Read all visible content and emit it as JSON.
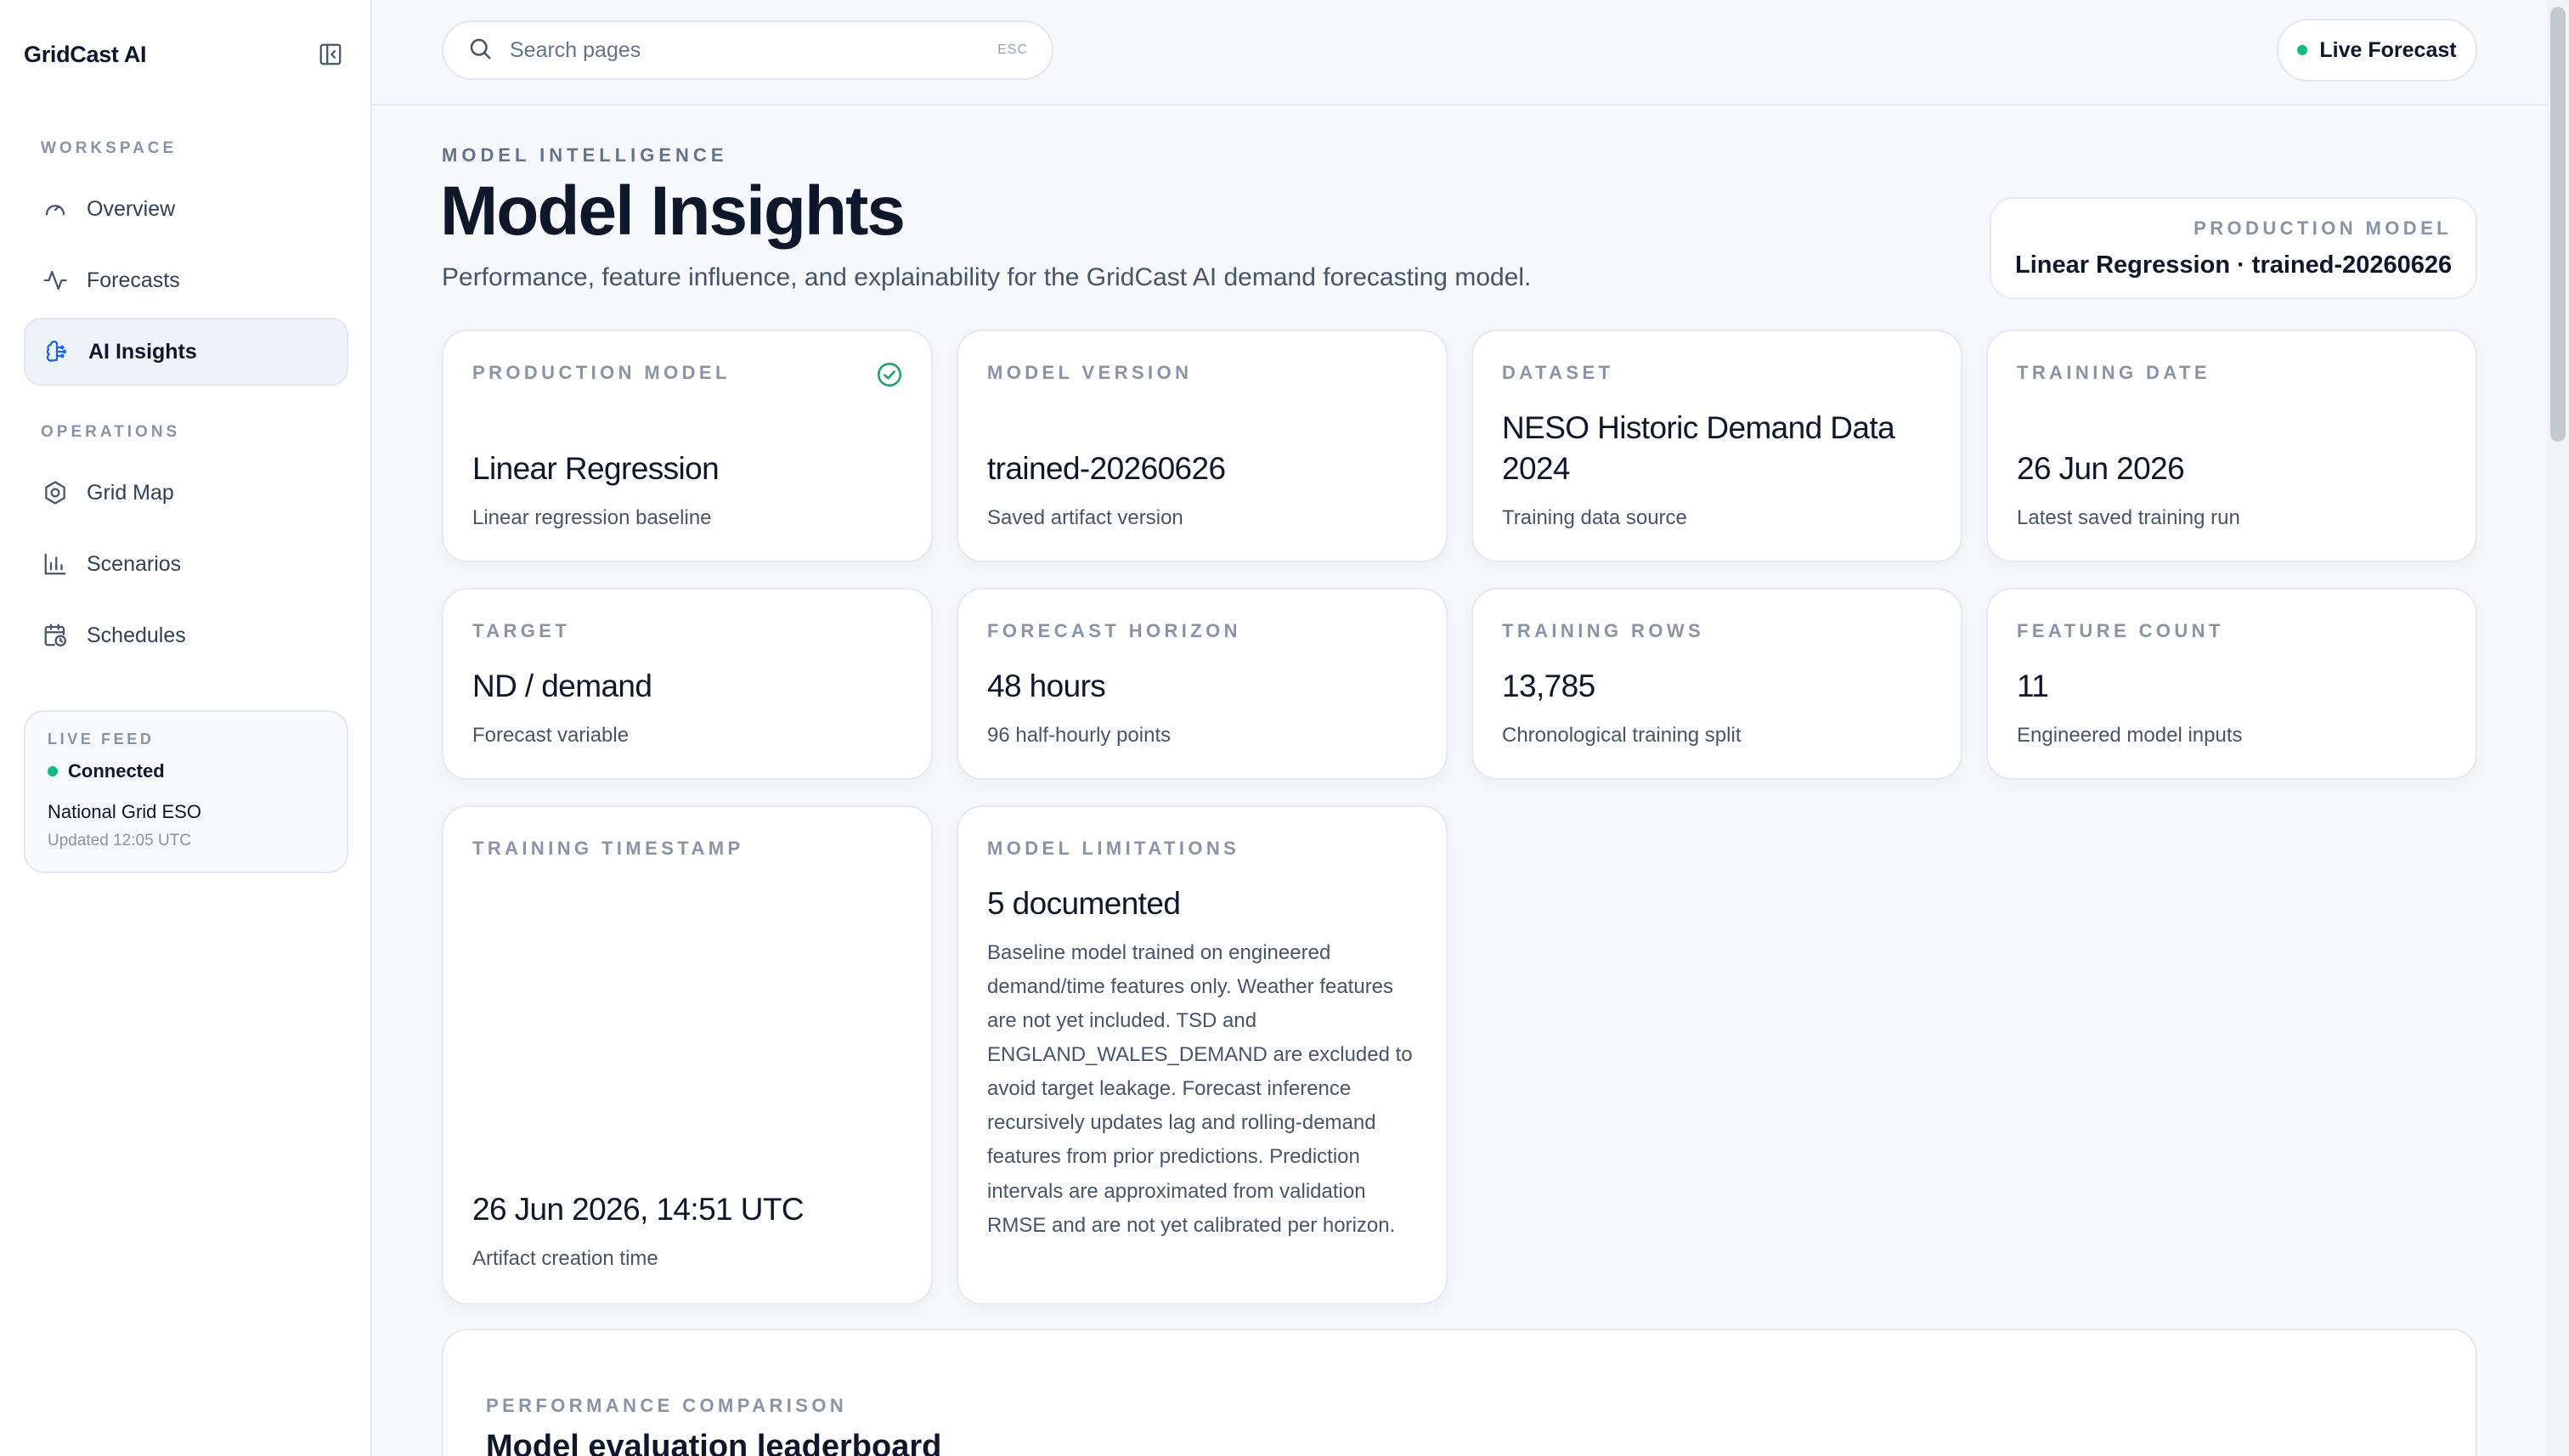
{
  "app": {
    "name": "GridCast AI"
  },
  "sidebar": {
    "workspace_label": "WORKSPACE",
    "operations_label": "OPERATIONS",
    "items": [
      {
        "label": "Overview",
        "icon": "gauge-icon"
      },
      {
        "label": "Forecasts",
        "icon": "activity-icon"
      },
      {
        "label": "AI Insights",
        "icon": "brain-icon",
        "active": true
      },
      {
        "label": "Grid Map",
        "icon": "hexagon-icon"
      },
      {
        "label": "Scenarios",
        "icon": "bar-chart-icon"
      },
      {
        "label": "Schedules",
        "icon": "calendar-clock-icon"
      }
    ],
    "live_feed": {
      "label": "LIVE FEED",
      "status": "Connected",
      "source": "National Grid ESO",
      "updated": "Updated 12:05 UTC"
    }
  },
  "topbar": {
    "search_placeholder": "Search pages",
    "search_shortcut": "ESC",
    "live_button": "Live Forecast"
  },
  "header": {
    "eyebrow": "MODEL INTELLIGENCE",
    "title": "Model Insights",
    "subtitle": "Performance, feature influence, and explainability for the GridCast AI demand forecasting model.",
    "production_model_label": "PRODUCTION MODEL",
    "production_model_value": "Linear Regression · trained-20260626"
  },
  "cards": {
    "production_model": {
      "label": "PRODUCTION MODEL",
      "value": "Linear Regression",
      "sub": "Linear regression baseline"
    },
    "model_version": {
      "label": "MODEL VERSION",
      "value": "trained-20260626",
      "sub": "Saved artifact version"
    },
    "dataset": {
      "label": "DATASET",
      "value": "NESO Historic Demand Data 2024",
      "sub": "Training data source"
    },
    "training_date": {
      "label": "TRAINING DATE",
      "value": "26 Jun 2026",
      "sub": "Latest saved training run"
    },
    "target": {
      "label": "TARGET",
      "value": "ND / demand",
      "sub": "Forecast variable"
    },
    "forecast_horizon": {
      "label": "FORECAST HORIZON",
      "value": "48 hours",
      "sub": "96 half-hourly points"
    },
    "training_rows": {
      "label": "TRAINING ROWS",
      "value": "13,785",
      "sub": "Chronological training split"
    },
    "feature_count": {
      "label": "FEATURE COUNT",
      "value": "11",
      "sub": "Engineered model inputs"
    },
    "training_timestamp": {
      "label": "TRAINING TIMESTAMP",
      "value": "26 Jun 2026, 14:51 UTC",
      "sub": "Artifact creation time"
    },
    "model_limitations": {
      "label": "MODEL LIMITATIONS",
      "value": "5 documented",
      "text": "Baseline model trained on engineered demand/time features only. Weather features are not yet included. TSD and ENGLAND_WALES_DEMAND are excluded to avoid target leakage. Forecast inference recursively updates lag and rolling-demand features from prior predictions. Prediction intervals are approximated from validation RMSE and are not yet calibrated per horizon."
    }
  },
  "performance": {
    "label": "PERFORMANCE COMPARISON",
    "title": "Model evaluation leaderboard"
  },
  "colors": {
    "accent": "#2563eb",
    "status_ok": "#10b981",
    "check": "#22a06b"
  }
}
